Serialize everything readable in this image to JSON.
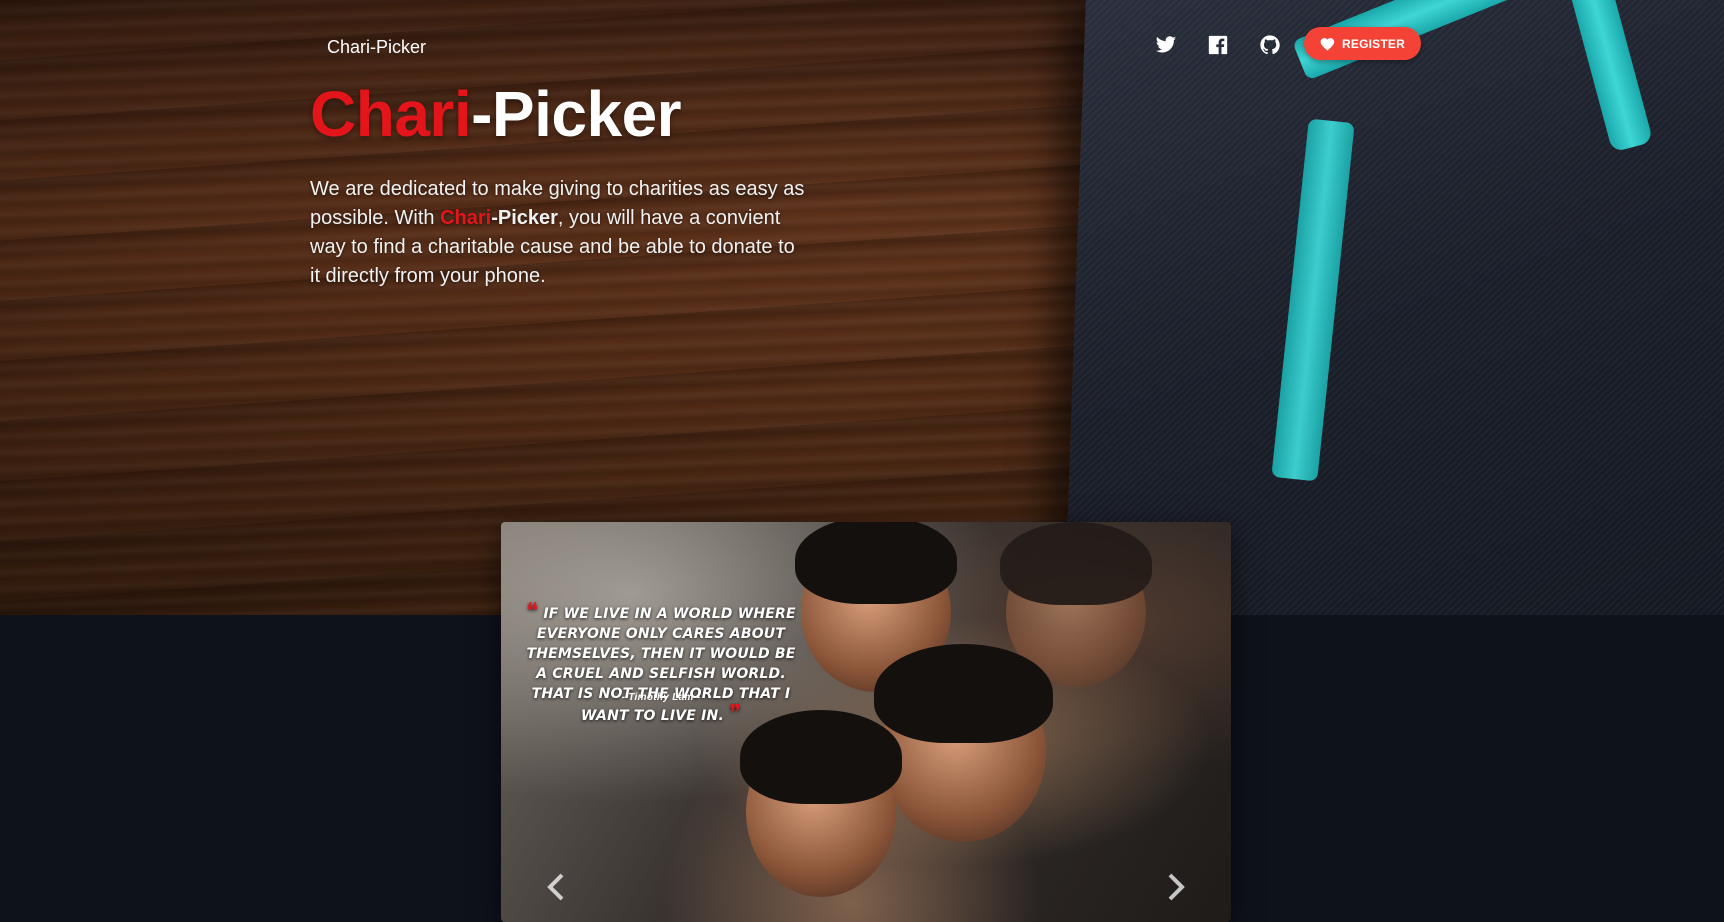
{
  "brand": {
    "nav_name": "Chari-Picker"
  },
  "nav": {
    "icons": [
      "twitter-icon",
      "facebook-icon",
      "github-icon"
    ],
    "register_label": "REGISTER",
    "register_icon": "heart-icon",
    "register_color": "#f44336"
  },
  "hero": {
    "title_red": "Chari",
    "title_white": "-Picker",
    "desc_part1": "We are dedicated to make giving to charities as easy as possible. With ",
    "desc_brand_red": "Chari",
    "desc_brand_white": "-Picker",
    "desc_part2": ", you will have a convient way to find a charitable cause and be able to donate to it directly from your phone.",
    "accent_color": "#e3151a"
  },
  "carousel": {
    "quote_text": "If we live in a world where everyone only cares about themselves, then it would be a cruel and selfish world. That is not the world that I want to live in.",
    "quote_author": "- Timothy Lam -",
    "prev_icon": "chevron-left-icon",
    "next_icon": "chevron-right-icon"
  }
}
